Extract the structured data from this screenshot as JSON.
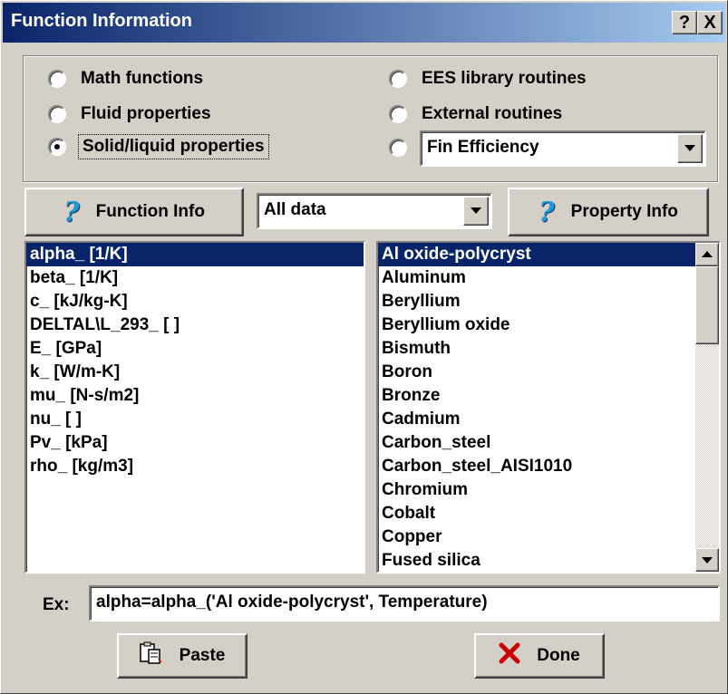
{
  "window": {
    "title": "Function Information",
    "help_button": "?",
    "close_button": "X"
  },
  "function_type": {
    "options": [
      {
        "label": "Math functions",
        "selected": false
      },
      {
        "label": "Fluid properties",
        "selected": false
      },
      {
        "label": "Solid/liquid properties",
        "selected": true
      },
      {
        "label": "EES library routines",
        "selected": false
      },
      {
        "label": "External routines",
        "selected": false
      },
      {
        "label": "",
        "selected": false
      }
    ],
    "library_dropdown_value": "Fin Efficiency"
  },
  "toolbar": {
    "function_info_label": "Function Info",
    "filter_value": "All data",
    "property_info_label": "Property Info"
  },
  "functions_list": {
    "items": [
      "alpha_ [1/K]",
      "beta_ [1/K]",
      "c_ [kJ/kg-K]",
      "DELTAL\\L_293_ [ ]",
      "E_ [GPa]",
      "k_ [W/m-K]",
      "mu_ [N-s/m2]",
      "nu_ [ ]",
      "Pv_ [kPa]",
      "rho_ [kg/m3]"
    ],
    "selected_index": 0
  },
  "materials_list": {
    "items": [
      "Al oxide-polycryst",
      "Aluminum",
      "Beryllium",
      "Beryllium oxide",
      "Bismuth",
      "Boron",
      "Bronze",
      "Cadmium",
      "Carbon_steel",
      "Carbon_steel_AISI1010",
      "Chromium",
      "Cobalt",
      "Copper",
      "Fused silica"
    ],
    "selected_index": 0
  },
  "example": {
    "label": "Ex:",
    "text": "alpha=alpha_('Al oxide-polycryst', Temperature)"
  },
  "actions": {
    "paste_label": "Paste",
    "done_label": "Done"
  },
  "icons": {
    "help": "question-mark-icon",
    "paste": "paste-icon",
    "done": "red-x-icon"
  },
  "colors": {
    "selection": "#0a246a",
    "titlebar_start": "#0a246a",
    "titlebar_end": "#a6caf0",
    "help_icon": "#1f9ad6",
    "done_x": "#cc0000"
  }
}
